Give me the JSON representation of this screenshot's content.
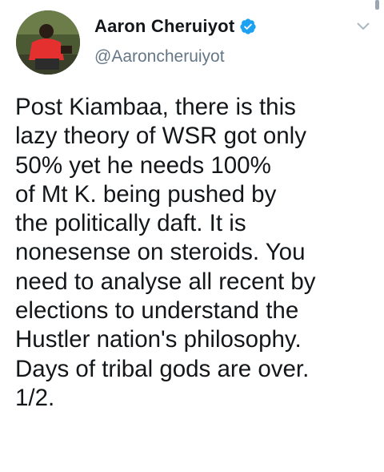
{
  "author": {
    "display_name": "Aaron Cheruiyot",
    "handle": "@Aaroncheruiyot",
    "verified": true,
    "avatar_icon": "profile-photo"
  },
  "tweet": {
    "text": "Post Kiambaa, there is this\nlazy theory of WSR got only\n50% yet he needs 100%\nof Mt K. being pushed by\nthe politically daft. It is\nnonesense on steroids. You\nneed to analyse all recent by\nelections to understand the\nHustler nation's philosophy.\nDays of tribal gods are over.\n1/2."
  },
  "icons": {
    "verified": "verified-badge-icon",
    "menu": "chevron-down-icon"
  },
  "colors": {
    "primary_text": "#14171a",
    "secondary_text": "#657786",
    "accent": "#1da1f2"
  }
}
